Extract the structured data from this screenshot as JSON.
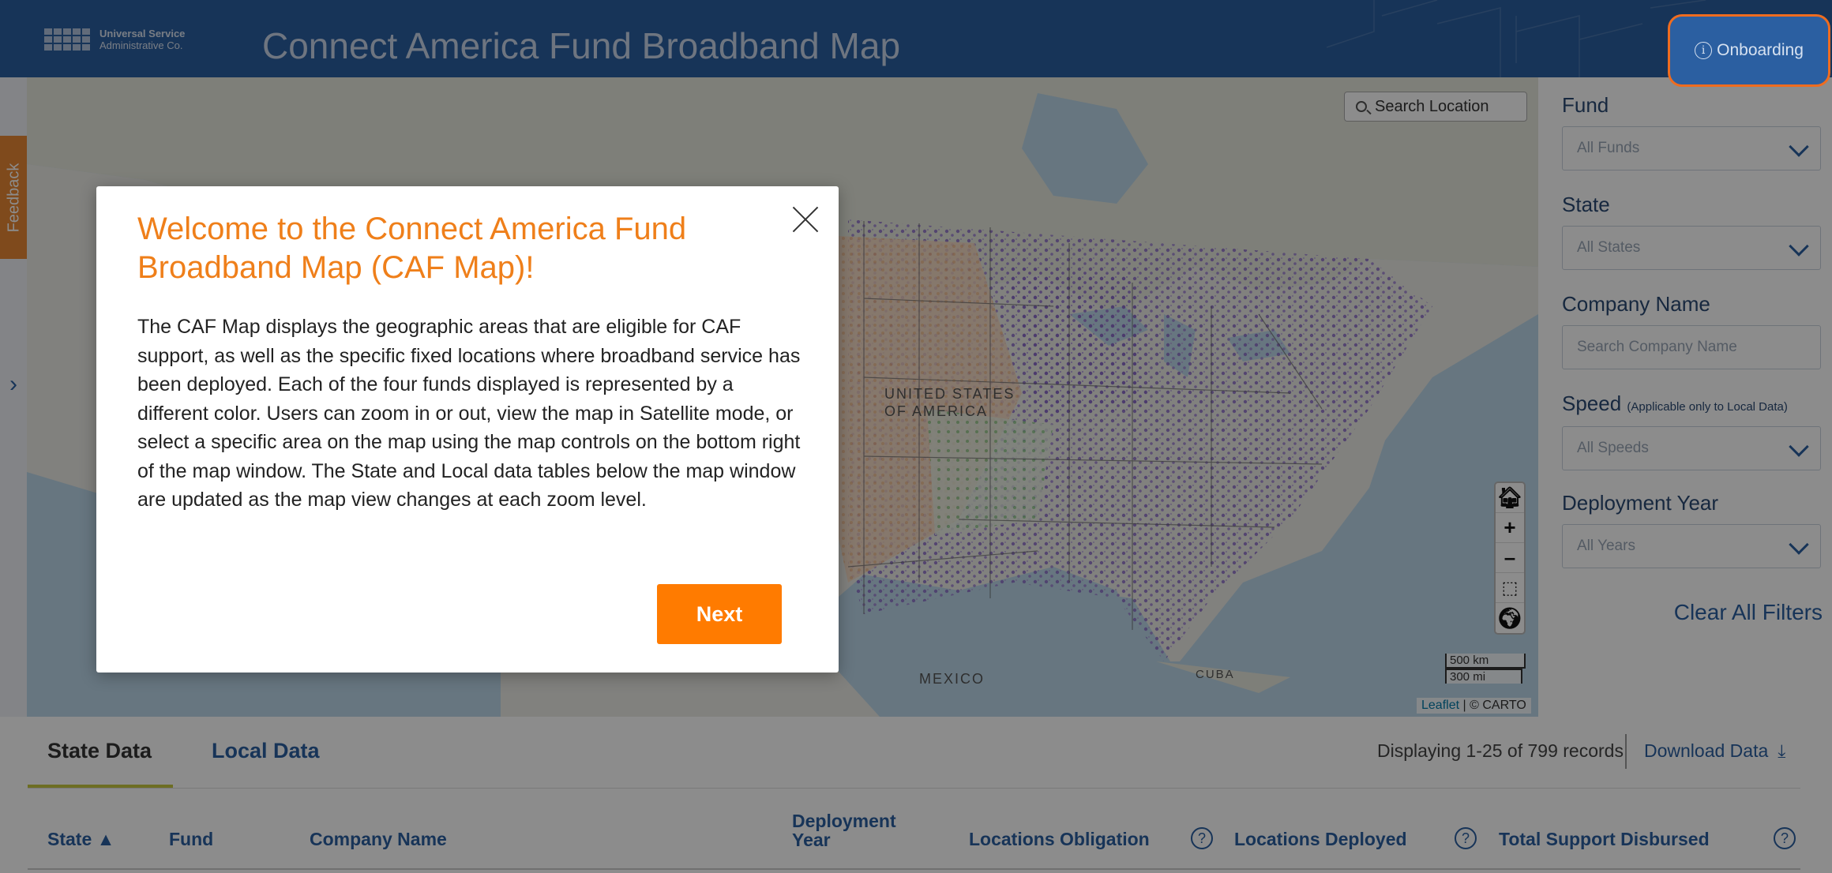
{
  "header": {
    "logo_line1": "Universal Service",
    "logo_line2": "Administrative Co.",
    "title": "Connect America Fund Broadband Map",
    "onboarding_label": "Onboarding"
  },
  "feedback_label": "Feedback",
  "map": {
    "search_placeholder": "Search Location",
    "labels": {
      "usa": "UNITED STATES\nOF AMERICA",
      "mexico": "MEXICO",
      "cuba": "CUBA"
    },
    "scale_km": "500 km",
    "scale_mi": "300 mi",
    "attribution_leaflet": "Leaflet",
    "attribution_carto": "| © CARTO",
    "controls": [
      "home-icon",
      "zoom-in-icon",
      "zoom-out-icon",
      "box-select-icon",
      "satellite-globe-icon"
    ]
  },
  "filters": {
    "fund_label": "Fund",
    "fund_value": "All Funds",
    "state_label": "State",
    "state_value": "All States",
    "company_label": "Company Name",
    "company_placeholder": "Search Company Name",
    "speed_label": "Speed",
    "speed_note": "(Applicable only to Local Data)",
    "speed_value": "All Speeds",
    "year_label": "Deployment Year",
    "year_value": "All Years",
    "clear_label": "Clear All Filters"
  },
  "table": {
    "tabs": [
      "State Data",
      "Local Data"
    ],
    "records_text": "Displaying 1-25 of 799 records",
    "download_label": "Download Data",
    "columns": {
      "state": "State ▲",
      "fund": "Fund",
      "company": "Company Name",
      "year_line1": "Deployment",
      "year_line2": "Year",
      "obligation": "Locations Obligation",
      "deployed": "Locations Deployed",
      "disbursed": "Total Support Disbursed"
    }
  },
  "modal": {
    "title": "Welcome to the Connect America Fund Broadband Map (CAF Map)!",
    "body": "The CAF Map displays the geographic areas that are eligible for CAF support, as well as the specific fixed locations where broadband service has been deployed. Each of the four funds displayed is represented by a different color. Users can zoom in or out, view the map in Satellite mode, or select a specific area on the map using the map controls on the bottom right of the map window. The State and Local data tables below the map window are updated as the map view changes at each zoom level.",
    "next_label": "Next"
  },
  "colors": {
    "brand_blue": "#2b5fa1",
    "accent_orange": "#ef7f1a",
    "button_orange": "#ff7b00",
    "fund_purple": "#8b6cc7",
    "fund_peach": "#f2b98a",
    "fund_green": "#8cc98a",
    "highlight_ring": "#ef6c1f"
  }
}
